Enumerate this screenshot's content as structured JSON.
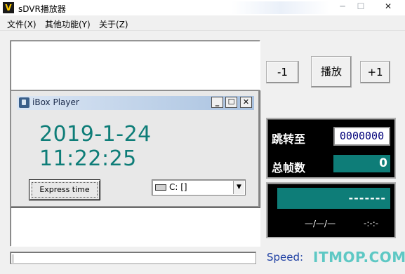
{
  "window": {
    "title": "sDVR播放器",
    "icon_label": "V",
    "minimize_glyph": "─",
    "maximize_glyph": "☐",
    "close_glyph": "✕"
  },
  "menu": {
    "items": [
      {
        "label": "文件(X)"
      },
      {
        "label": "其他功能(Y)"
      },
      {
        "label": "关于(Z)"
      }
    ]
  },
  "controls": {
    "prev_label": "-1",
    "play_label": "播放",
    "next_label": "+1"
  },
  "jump_panel": {
    "jump_label": "跳转至",
    "jump_value": "0000000",
    "total_label": "总帧数",
    "total_value": "0"
  },
  "status_panel": {
    "bar_text": "-------",
    "time_left": "—/—/—",
    "time_right": "-:-:-"
  },
  "footer": {
    "speed_label": "Speed:",
    "watermark": "ITMOP.COM"
  },
  "ibox": {
    "title": "iBox Player",
    "minimize_glyph": "_",
    "maximize_glyph": "☐",
    "close_glyph": "✕",
    "clock": "2019-1-24 11:22:25",
    "express_button_label": "Express time",
    "drive_value": "C: []",
    "drive_arrow": "▼"
  },
  "colors": {
    "teal": "#0e7d78",
    "speed_blue": "#1e3fa3",
    "watermark": "#5ec8c4"
  }
}
